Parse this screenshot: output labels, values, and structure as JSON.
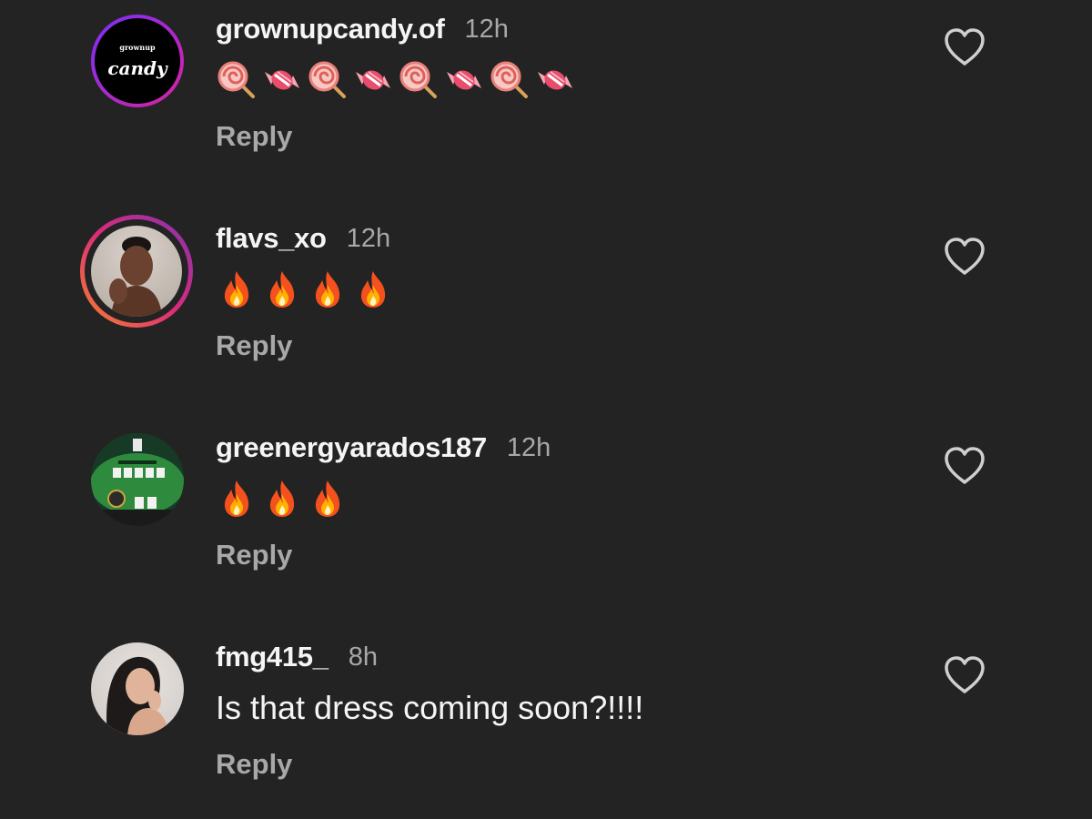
{
  "comments": [
    {
      "username": "grownupcandy.of",
      "time": "12h",
      "text": "",
      "emojis": [
        "lollipop",
        "candy",
        "lollipop",
        "candy",
        "lollipop",
        "candy",
        "lollipop",
        "candy"
      ],
      "reply_label": "Reply",
      "avatar": {
        "type": "logo",
        "small_text": "grownup",
        "big_text": "candy",
        "ring_colors": [
          "#7b2ff7",
          "#d6249f"
        ]
      }
    },
    {
      "username": "flavs_xo",
      "time": "12h",
      "text": "",
      "emojis": [
        "fire",
        "fire",
        "fire",
        "fire"
      ],
      "reply_label": "Reply",
      "avatar": {
        "type": "photo",
        "ring_colors": [
          "#f58529",
          "#dd2a7b",
          "#8134af"
        ]
      }
    },
    {
      "username": "greenergyarados187",
      "time": "12h",
      "text": "",
      "emojis": [
        "fire",
        "fire",
        "fire"
      ],
      "reply_label": "Reply",
      "avatar": {
        "type": "poker-table"
      }
    },
    {
      "username": "fmg415_",
      "time": "8h",
      "text": "Is that dress coming soon?!!!!",
      "emojis": [],
      "reply_label": "Reply",
      "avatar": {
        "type": "photo"
      }
    }
  ],
  "colors": {
    "background": "#232323",
    "username": "#f5f5f5",
    "secondary": "#a8a8a8",
    "heart_outline": "#cfcfcf"
  },
  "icons": {
    "like": "heart-outline-icon",
    "fire": "fire-emoji-icon",
    "lollipop": "lollipop-emoji-icon",
    "candy": "candy-emoji-icon"
  }
}
